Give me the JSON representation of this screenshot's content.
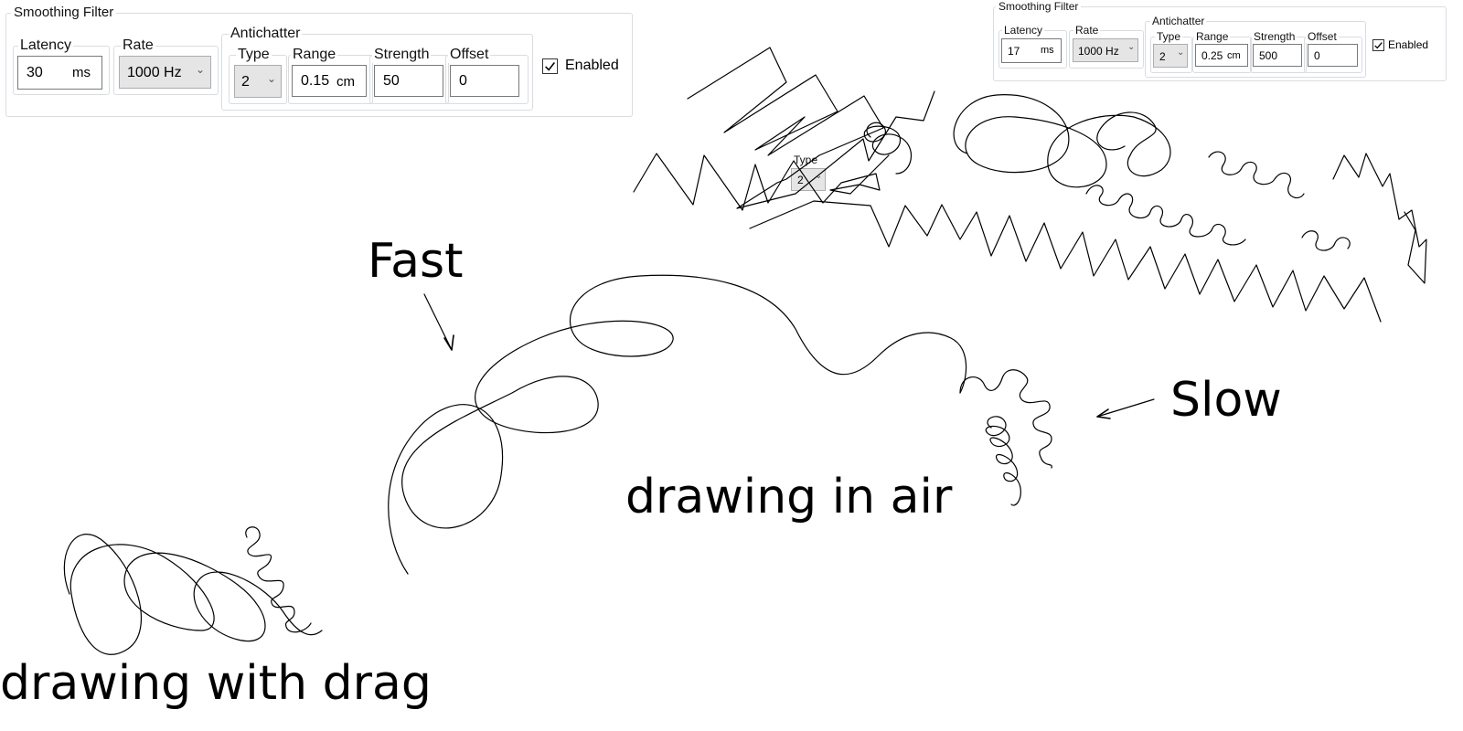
{
  "panel_large": {
    "title": "Smoothing Filter",
    "latency": {
      "label": "Latency",
      "value": "30",
      "unit": "ms"
    },
    "rate": {
      "label": "Rate",
      "value": "1000 Hz"
    },
    "antichatter": {
      "label": "Antichatter",
      "type": {
        "label": "Type",
        "value": "2"
      },
      "range": {
        "label": "Range",
        "value": "0.15",
        "unit": "cm"
      },
      "strength": {
        "label": "Strength",
        "value": "50"
      },
      "offset": {
        "label": "Offset",
        "value": "0"
      }
    },
    "enabled": {
      "label": "Enabled",
      "checked": true
    }
  },
  "panel_small": {
    "title": "Smoothing Filter",
    "latency": {
      "label": "Latency",
      "value": "17",
      "unit": "ms"
    },
    "rate": {
      "label": "Rate",
      "value": "1000 Hz"
    },
    "antichatter": {
      "label": "Antichatter",
      "type": {
        "label": "Type",
        "value": "2"
      },
      "range": {
        "label": "Range",
        "value": "0.25",
        "unit": "cm"
      },
      "strength": {
        "label": "Strength",
        "value": "500"
      },
      "offset": {
        "label": "Offset",
        "value": "0"
      }
    },
    "enabled": {
      "label": "Enabled",
      "checked": true
    }
  },
  "floating_type": {
    "label": "Type",
    "value": "2"
  },
  "annotations": {
    "fast": "Fast",
    "slow": "Slow",
    "drawing_in_air": "drawing in air",
    "drawing_with_drag": "drawing with drag"
  },
  "colors": {
    "stroke": "#000000",
    "border": "#d8dde3",
    "select_bg": "#e5e5e5"
  },
  "icons": {
    "dropdown": "chevron-down-icon",
    "checkbox": "checkmark-icon",
    "arrow": "arrow-icon"
  }
}
